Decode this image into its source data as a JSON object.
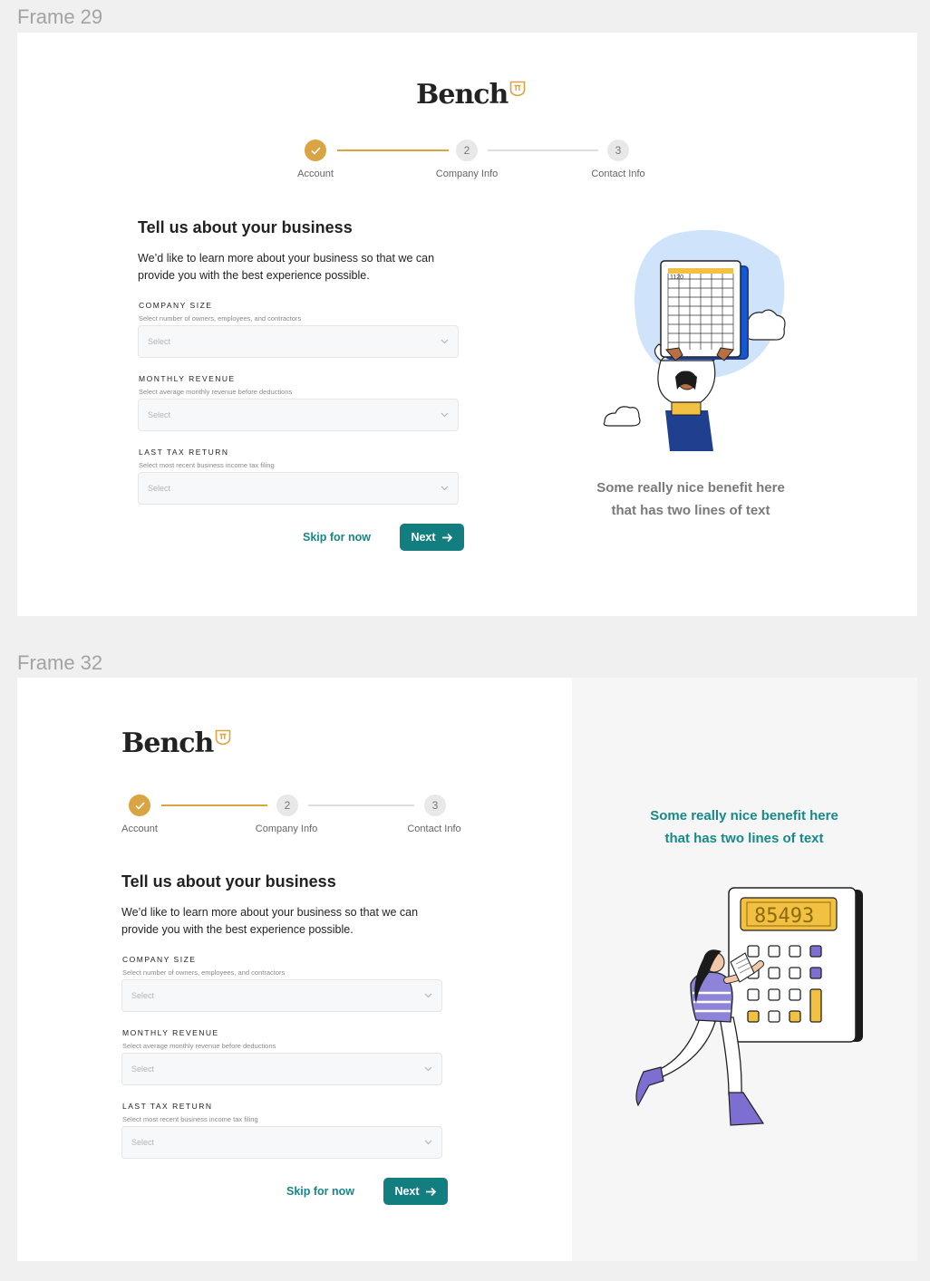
{
  "frames": [
    {
      "label": "Frame 29",
      "logo": "Bench",
      "steps": [
        {
          "label": "Account",
          "number": "✓",
          "state": "complete"
        },
        {
          "label": "Company Info",
          "number": "2",
          "state": "upcoming"
        },
        {
          "label": "Contact Info",
          "number": "3",
          "state": "upcoming"
        }
      ],
      "heading": "Tell us about your business",
      "lead": "We’d like to learn more about your business so that we can provide you with the best experience possible.",
      "fields": [
        {
          "label": "COMPANY SIZE",
          "help": "Select number of owners, employees, and contractors",
          "placeholder": "Select"
        },
        {
          "label": "MONTHLY REVENUE",
          "help": "Select average monthly revenue before deductions",
          "placeholder": "Select"
        },
        {
          "label": "LAST TAX RETURN",
          "help": "Select most recent business income tax filing",
          "placeholder": "Select"
        }
      ],
      "skip_label": "Skip for now",
      "next_label": "Next",
      "benefit_line1": "Some really nice benefit here",
      "benefit_line2": "that has two lines of text",
      "illustration_text": "1120"
    },
    {
      "label": "Frame 32",
      "logo": "Bench",
      "steps": [
        {
          "label": "Account",
          "number": "✓",
          "state": "complete"
        },
        {
          "label": "Company Info",
          "number": "2",
          "state": "upcoming"
        },
        {
          "label": "Contact Info",
          "number": "3",
          "state": "upcoming"
        }
      ],
      "heading": "Tell us about your business",
      "lead": "We’d like to learn more about your business so that we can provide you with the best experience possible.",
      "fields": [
        {
          "label": "COMPANY SIZE",
          "help": "Select number of owners, employees, and contractors",
          "placeholder": "Select"
        },
        {
          "label": "MONTHLY REVENUE",
          "help": "Select average monthly revenue before deductions",
          "placeholder": "Select"
        },
        {
          "label": "LAST TAX RETURN",
          "help": "Select most recent business income tax filing",
          "placeholder": "Select"
        }
      ],
      "skip_label": "Skip for now",
      "next_label": "Next",
      "benefit_line1": "Some really nice benefit here",
      "benefit_line2": "that has two lines of text",
      "illustration_text": "85493"
    }
  ],
  "colors": {
    "accent_gold": "#d9a441",
    "primary_teal": "#137e80",
    "benefit_gray": "#7a7a7a",
    "benefit_teal": "#16898b"
  }
}
